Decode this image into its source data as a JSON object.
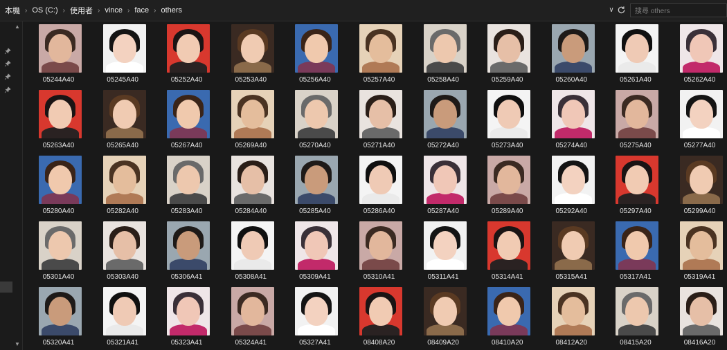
{
  "address": {
    "segments": [
      "本機",
      "OS (C:)",
      "使用者",
      "vince",
      "face",
      "others"
    ]
  },
  "search": {
    "placeholder": "搜尋 others"
  },
  "files": [
    "05244A40",
    "05245A40",
    "05252A40",
    "05253A40",
    "05256A40",
    "05257A40",
    "05258A40",
    "05259A40",
    "05260A40",
    "05261A40",
    "05262A40",
    "05263A40",
    "05265A40",
    "05267A40",
    "05269A40",
    "05270A40",
    "05271A40",
    "05272A40",
    "05273A40",
    "05274A40",
    "05275A40",
    "05277A40",
    "05280A40",
    "05282A40",
    "05283A40",
    "05284A40",
    "05285A40",
    "05286A40",
    "05287A40",
    "05289A40",
    "05292A40",
    "05297A40",
    "05299A40",
    "05301A40",
    "05303A40",
    "05306A41",
    "05308A41",
    "05309A41",
    "05310A41",
    "05311A41",
    "05314A41",
    "05315A41",
    "05317A41",
    "05319A41",
    "05320A41",
    "05321A41",
    "05323A41",
    "05324A41",
    "05327A41",
    "08408A20",
    "08409A20",
    "08410A20",
    "08412A20",
    "08415A20",
    "08416A20"
  ],
  "thumb_palette": [
    {
      "bg": "#c9a9a6",
      "hair": "#3b2a22",
      "skin": "#e2b79c",
      "cloth": "#7a4a4a"
    },
    {
      "bg": "#9aa7b0",
      "hair": "#1e1a18",
      "skin": "#c99b7b",
      "cloth": "#3b4a6a"
    },
    {
      "bg": "#e6d2b8",
      "hair": "#4a3322",
      "skin": "#e4bd9c",
      "cloth": "#b07a56"
    },
    {
      "bg": "#d8382e",
      "hair": "#1a1414",
      "skin": "#f1cbb3",
      "cloth": "#2a2222"
    },
    {
      "bg": "#efe6e8",
      "hair": "#3a3038",
      "skin": "#f0c7b7",
      "cloth": "#c22a6a"
    },
    {
      "bg": "#e9e3df",
      "hair": "#2a1e18",
      "skin": "#e6bfa7",
      "cloth": "#6a6a6a"
    },
    {
      "bg": "#3a6ab0",
      "hair": "#3a2418",
      "skin": "#f0c9ad",
      "cloth": "#7a3a5a"
    },
    {
      "bg": "#f2f2f2",
      "hair": "#141414",
      "skin": "#f3d2c0",
      "cloth": "#ffffff"
    },
    {
      "bg": "#f4f4f4",
      "hair": "#101010",
      "skin": "#efcab5",
      "cloth": "#eaeaea"
    },
    {
      "bg": "#d9d2c8",
      "hair": "#6a6a6a",
      "skin": "#edc8ae",
      "cloth": "#4a4a4a"
    },
    {
      "bg": "#3a2a22",
      "hair": "#5a3a22",
      "skin": "#f0cbb2",
      "cloth": "#8a6a4a"
    }
  ]
}
